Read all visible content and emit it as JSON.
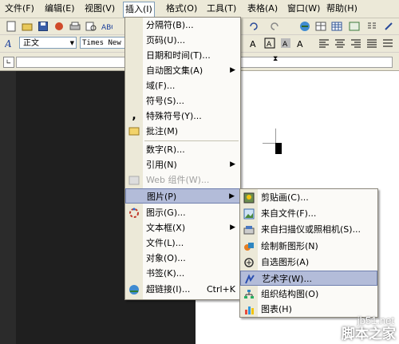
{
  "menubar": {
    "items": [
      "文件(F)",
      "编辑(E)",
      "视图(V)",
      "插入(I)",
      "格式(O)",
      "工具(T)",
      "表格(A)",
      "窗口(W)",
      "帮助(H)"
    ],
    "active_index": 3
  },
  "format_toolbar": {
    "style_value": "正文",
    "font_value": "Times New R"
  },
  "insert_menu": {
    "items": [
      {
        "label": "分隔符(B)..."
      },
      {
        "label": "页码(U)..."
      },
      {
        "label": "日期和时间(T)..."
      },
      {
        "label": "自动图文集(A)",
        "submenu": true
      },
      {
        "label": "域(F)..."
      },
      {
        "label": "符号(S)..."
      },
      {
        "label": "特殊符号(Y)..."
      },
      {
        "label": "批注(M)"
      },
      {
        "label": "数字(R)..."
      },
      {
        "label": "引用(N)",
        "submenu": true
      },
      {
        "label": "Web 组件(W)...",
        "disabled": true
      },
      {
        "label": "图片(P)",
        "submenu": true,
        "highlighted": true
      },
      {
        "label": "图示(G)..."
      },
      {
        "label": "文本框(X)",
        "submenu": true
      },
      {
        "label": "文件(L)..."
      },
      {
        "label": "对象(O)..."
      },
      {
        "label": "书签(K)..."
      },
      {
        "label": "超链接(I)...",
        "shortcut": "Ctrl+K"
      }
    ]
  },
  "picture_submenu": {
    "items": [
      {
        "label": "剪贴画(C)...",
        "icon": "clipart-icon"
      },
      {
        "label": "来自文件(F)...",
        "icon": "picture-file-icon"
      },
      {
        "label": "来自扫描仪或照相机(S)...",
        "icon": "scanner-icon"
      },
      {
        "label": "绘制新图形(N)",
        "icon": "new-drawing-icon"
      },
      {
        "label": "自选图形(A)",
        "icon": "autoshapes-icon"
      },
      {
        "label": "艺术字(W)...",
        "icon": "wordart-icon",
        "highlighted": true
      },
      {
        "label": "组织结构图(O)",
        "icon": "org-chart-icon"
      },
      {
        "label": "图表(H)",
        "icon": "chart-icon"
      }
    ]
  },
  "watermark": {
    "site": "jb51.net",
    "name": "脚本之家"
  },
  "colors": {
    "menu_highlight": "#b3bcd9",
    "toolbar_bg": "#ece9d8"
  }
}
